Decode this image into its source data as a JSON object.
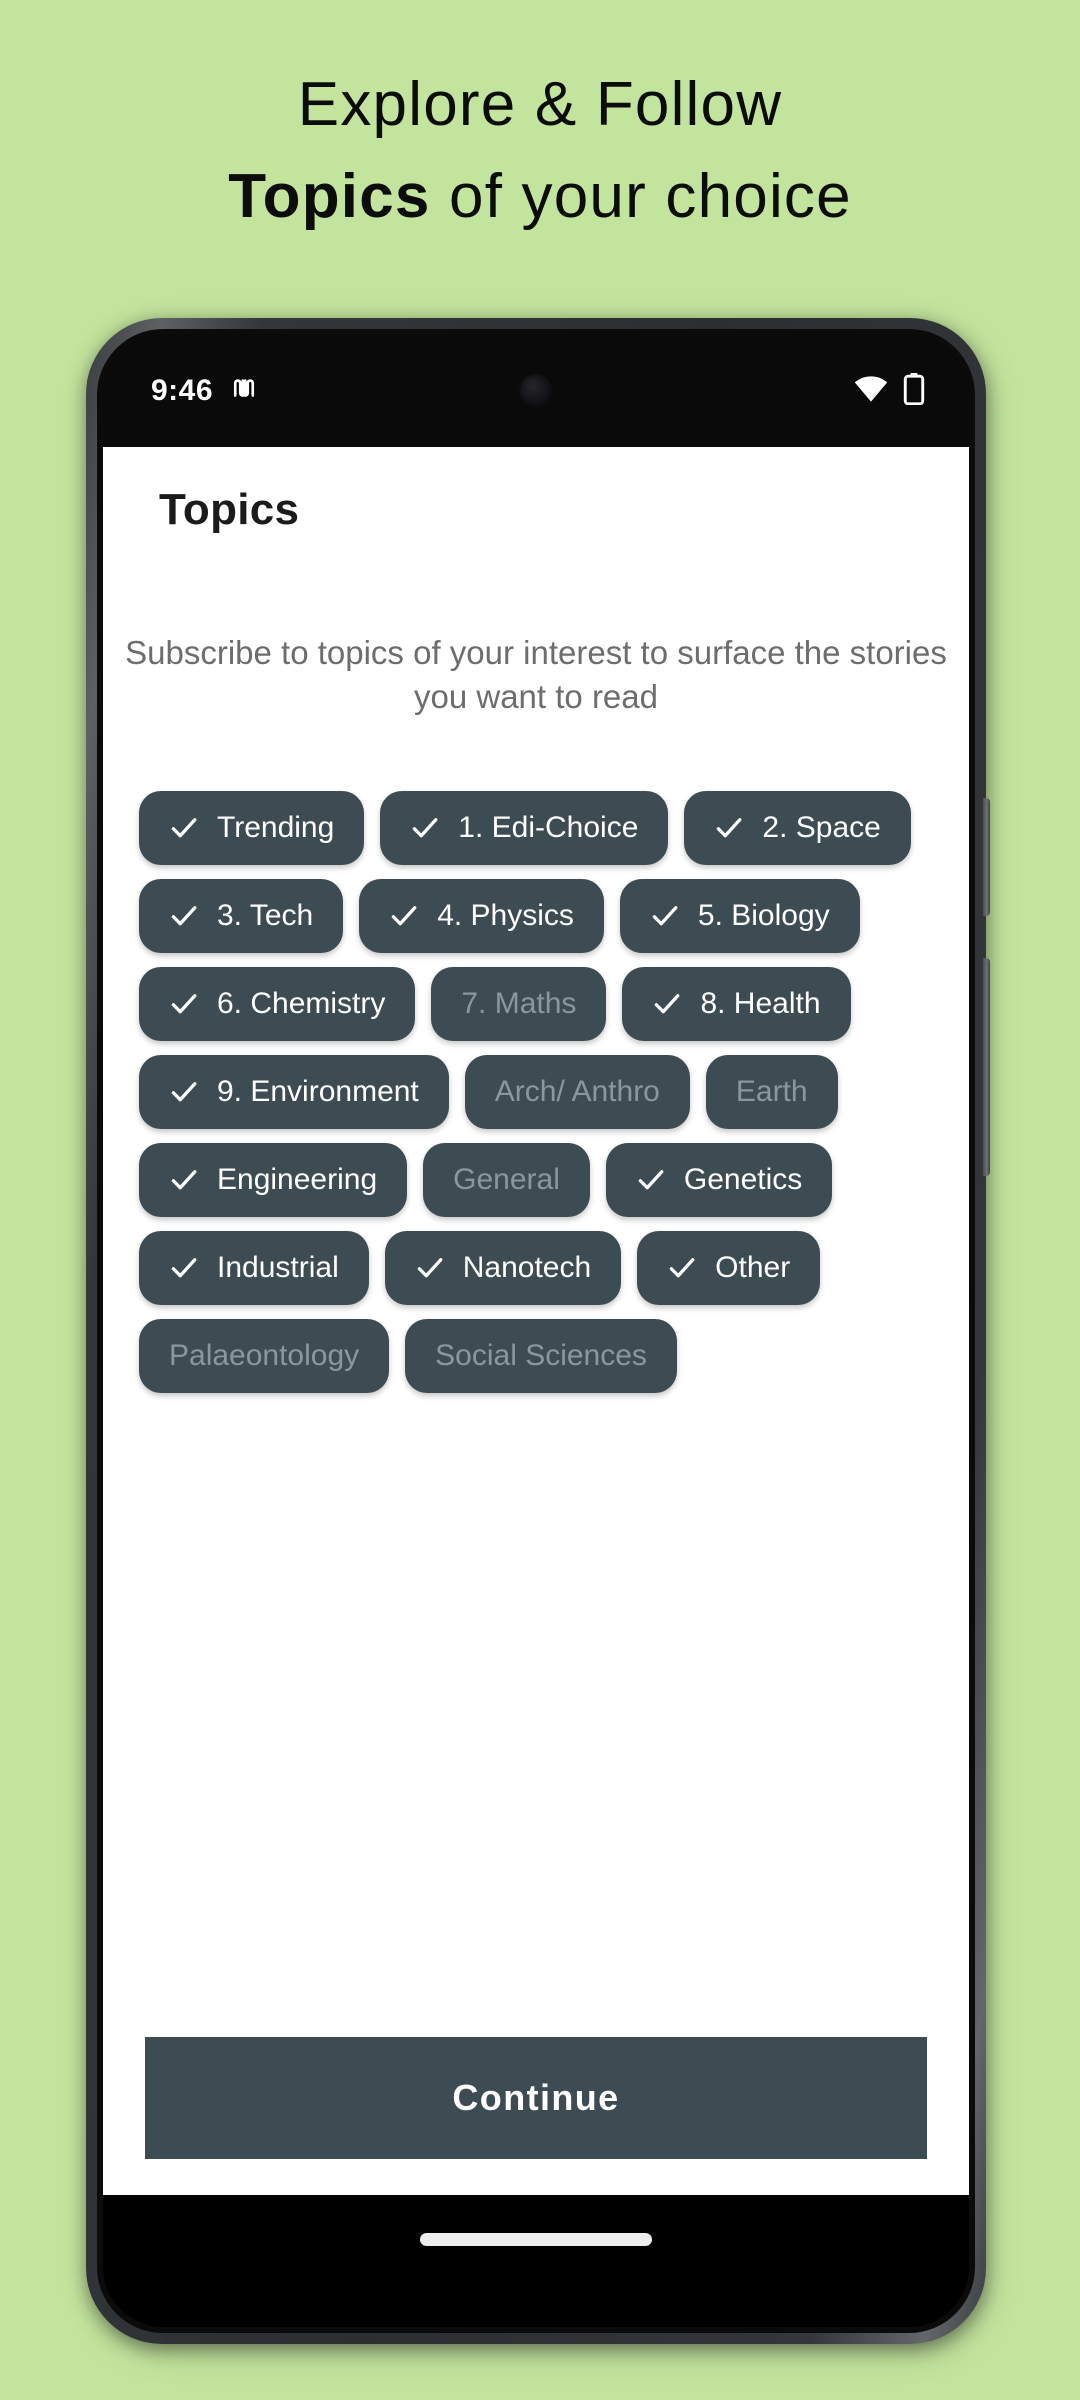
{
  "promo": {
    "line1": "Explore & Follow",
    "line2_bold": "Topics",
    "line2_rest": " of your choice",
    "background_color": "#c3e49d"
  },
  "status_bar": {
    "time": "9:46",
    "nfc_icon": "nfc-icon",
    "wifi_icon": "wifi-icon",
    "battery_icon": "battery-icon"
  },
  "app": {
    "title": "Topics",
    "subtitle": "Subscribe to topics of your interest to surface the stories you want to read",
    "accent_color": "#3d4b53",
    "selected_text_color": "#ffffff",
    "unselected_text_color": "#8b979d",
    "chips": [
      {
        "label": "Trending",
        "selected": true
      },
      {
        "label": "1. Edi-Choice",
        "selected": true
      },
      {
        "label": "2. Space",
        "selected": true
      },
      {
        "label": "3. Tech",
        "selected": true
      },
      {
        "label": "4. Physics",
        "selected": true
      },
      {
        "label": "5. Biology",
        "selected": true
      },
      {
        "label": "6. Chemistry",
        "selected": true
      },
      {
        "label": "7. Maths",
        "selected": false
      },
      {
        "label": "8. Health",
        "selected": true
      },
      {
        "label": "9. Environment",
        "selected": true
      },
      {
        "label": "Arch/ Anthro",
        "selected": false
      },
      {
        "label": "Earth",
        "selected": false
      },
      {
        "label": "Engineering",
        "selected": true
      },
      {
        "label": "General",
        "selected": false
      },
      {
        "label": "Genetics",
        "selected": true
      },
      {
        "label": "Industrial",
        "selected": true
      },
      {
        "label": "Nanotech",
        "selected": true
      },
      {
        "label": "Other",
        "selected": true
      },
      {
        "label": "Palaeontology",
        "selected": false
      },
      {
        "label": "Social Sciences",
        "selected": false
      }
    ],
    "continue_label": "Continue"
  }
}
